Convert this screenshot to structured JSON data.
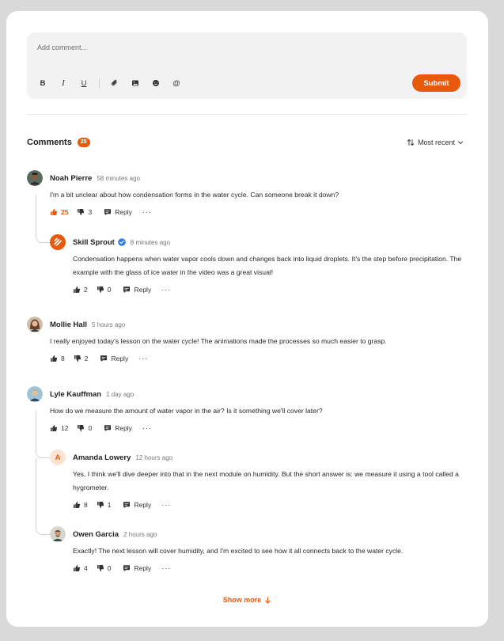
{
  "editor": {
    "placeholder": "Add comment...",
    "toolbar": [
      "bold-icon",
      "italic-icon",
      "underline-icon",
      "attachment-icon",
      "image-icon",
      "emoji-icon",
      "mention-icon"
    ],
    "bold_label": "B",
    "italic_label": "I",
    "underline_label": "U",
    "mention_label": "@",
    "submit_label": "Submit"
  },
  "comments_header": {
    "title": "Comments",
    "count": "25",
    "sort_label": "Most recent"
  },
  "comments": [
    {
      "name": "Noah Pierre",
      "time": "58 minutes ago",
      "text": "I'm a bit unclear about how condensation forms in the water cycle. Can someone break it down?",
      "likes": "25",
      "dislikes": "3",
      "reply_label": "Reply",
      "liked": true,
      "replies": [
        {
          "name": "Skill Sprout",
          "time": "8 minutes ago",
          "verified": true,
          "text": "Condensation happens when water vapor cools down and changes back into liquid droplets. It's the step before precipitation. The example with the glass of ice water in the video was a great visual!",
          "likes": "2",
          "dislikes": "0",
          "reply_label": "Reply"
        }
      ]
    },
    {
      "name": "Mollie Hall",
      "time": "5 hours ago",
      "text": "I really enjoyed today's lesson on the water cycle! The animations made the processes so much easier to grasp.",
      "likes": "8",
      "dislikes": "2",
      "reply_label": "Reply"
    },
    {
      "name": "Lyle Kauffman",
      "time": "1 day ago",
      "text": "How do we measure the amount of water vapor in the air? Is it something we'll cover later?",
      "likes": "12",
      "dislikes": "0",
      "reply_label": "Reply",
      "replies": [
        {
          "name": "Amanda Lowery",
          "time": "12 hours ago",
          "avatar_initial": "A",
          "text": "Yes, I think we'll dive deeper into that in the next module on humidity. But the short answer is: we measure it using a tool called a hygrometer.",
          "likes": "8",
          "dislikes": "1",
          "reply_label": "Reply"
        },
        {
          "name": "Owen Garcia",
          "time": "2 hours ago",
          "text": "Exactly! The next lesson will cover humidity, and I'm excited to see how it all connects back to the water cycle.",
          "likes": "4",
          "dislikes": "0",
          "reply_label": "Reply"
        }
      ]
    }
  ],
  "more_label": "···",
  "show_more_label": "Show more",
  "colors": {
    "accent": "#e8590c",
    "background": "#d9d9d9",
    "card": "#ffffff",
    "editor": "#f2f2f2"
  }
}
